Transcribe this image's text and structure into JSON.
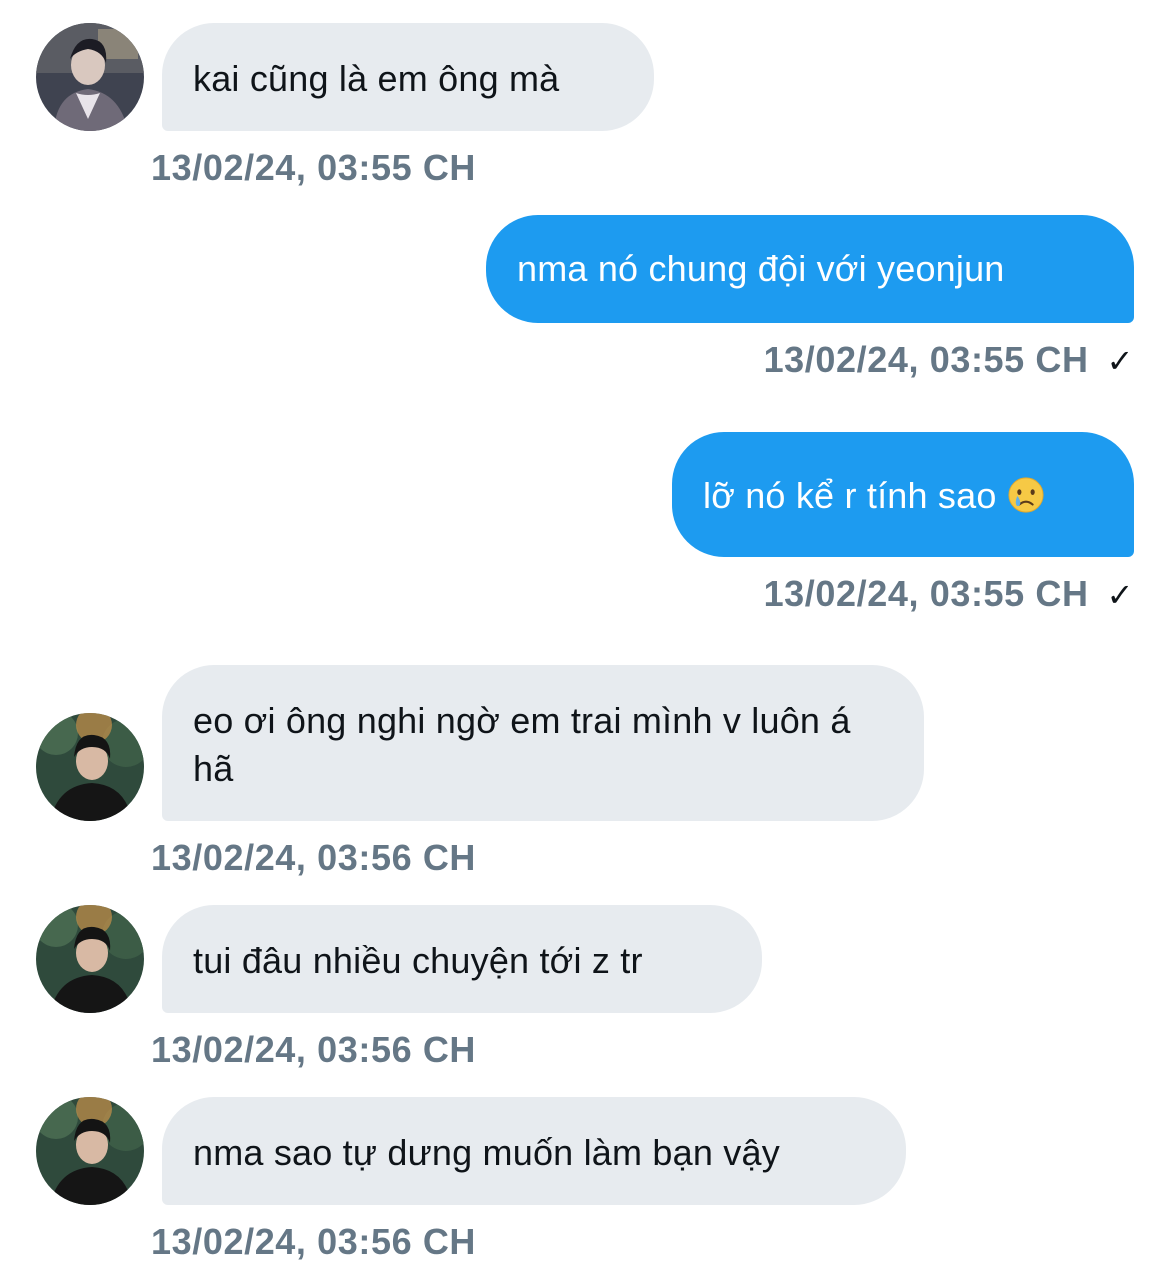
{
  "conversation": {
    "messages": [
      {
        "direction": "incoming",
        "text": "kai cũng là em ông mà",
        "timestamp": "13/02/24, 03:55 CH"
      },
      {
        "direction": "outgoing",
        "text": "nma nó chung đội với yeonjun",
        "timestamp": "13/02/24, 03:55 CH",
        "status": "✓"
      },
      {
        "direction": "outgoing",
        "text": "lỡ nó kể r tính sao",
        "emoji": "crying-face-emoji",
        "timestamp": "13/02/24, 03:55 CH",
        "status": "✓"
      },
      {
        "direction": "incoming",
        "text": "eo ơi ông nghi ngờ em trai mình v luôn á hã",
        "timestamp": "13/02/24, 03:56 CH"
      },
      {
        "direction": "incoming",
        "text": "tui đâu nhiều chuyện tới z tr",
        "timestamp": "13/02/24, 03:56 CH"
      },
      {
        "direction": "incoming",
        "text": "nma sao tự dưng muốn làm bạn vậy",
        "timestamp": "13/02/24, 03:56 CH"
      }
    ]
  },
  "colors": {
    "incoming_bubble": "#e7ebef",
    "outgoing_bubble": "#1d9bf0",
    "timestamp": "#657786",
    "text_dark": "#0f1419"
  }
}
